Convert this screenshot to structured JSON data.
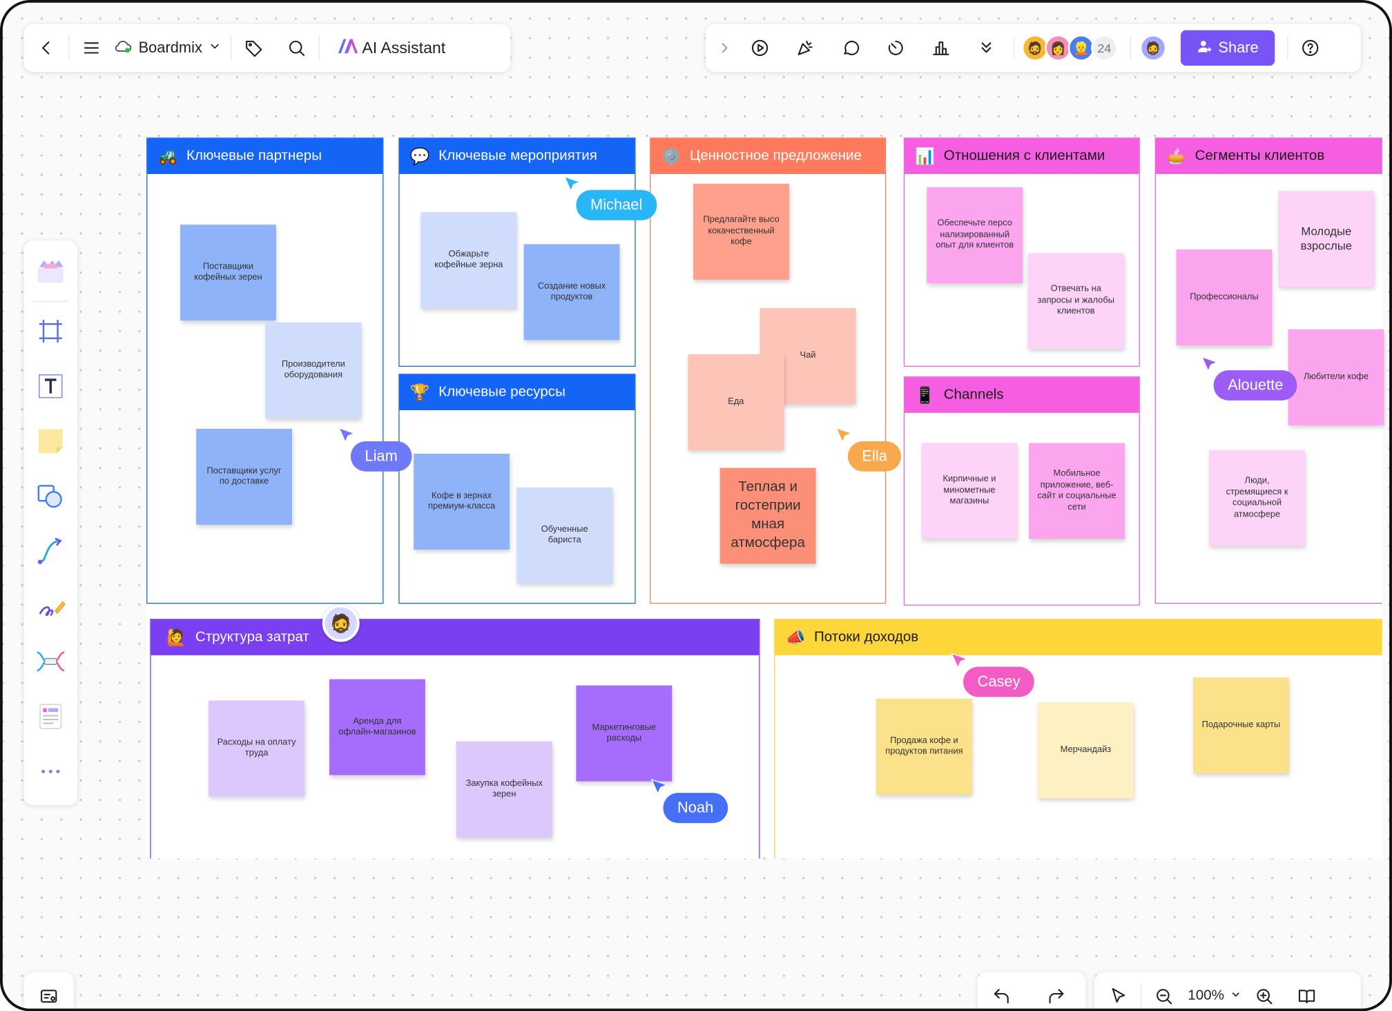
{
  "topbar": {
    "app_name": "Boardmix",
    "ai_label": "AI Assistant",
    "collab_count": "24",
    "share_label": "Share"
  },
  "zoom": {
    "value": "100%"
  },
  "colors": {
    "blue": "#1464f6",
    "salmon": "#ff7a5c",
    "pink": "#f55ee0",
    "purple": "#7b3ff2",
    "yellow": "#fdd73a",
    "share": "#7654f5"
  },
  "sections": {
    "partners": {
      "title": "Ключевые партнеры",
      "notes": [
        "Поставщики кофейных зерен",
        "Производители оборудования",
        "Поставщики услуг по доставке"
      ]
    },
    "activities": {
      "title": "Ключевые мероприятия",
      "notes": [
        "Обжарьте кофейные зерна",
        "Создание новых продуктов"
      ]
    },
    "resources": {
      "title": "Ключевые ресурсы",
      "notes": [
        "Кофе в зернах премиум-класса",
        "Обученные бариста"
      ]
    },
    "value": {
      "title": "Ценностное предложение",
      "notes": [
        "Предлагайте высо кокачественный кофе",
        "Чай",
        "Еда",
        "Теплая и гостеприи мная атмосфера"
      ]
    },
    "relations": {
      "title": "Отношения с клиентами",
      "notes": [
        "Обеспечьте персо нализированный опыт для клиентов",
        "Отвечать на запросы и жалобы клиентов"
      ]
    },
    "channels": {
      "title": "Channels",
      "notes": [
        "Кирпичные и минометные магазины",
        "Мобильное приложение, веб-сайт и социальные сети"
      ]
    },
    "segments": {
      "title": "Сегменты клиентов",
      "notes": [
        "Молодые взрослые",
        "Профессионалы",
        "Любители кофе",
        "Люди, стремящиеся к социальной атмосфере"
      ]
    },
    "costs": {
      "title": "Структура затрат",
      "notes": [
        "Расходы на оплату труда",
        "Аренда для офлайн-магазинов",
        "Закупка кофейных зерен",
        "Маркетинговые расходы"
      ]
    },
    "revenue": {
      "title": "Потоки доходов",
      "notes": [
        "Продажа кофе и продуктов питания",
        "Мерчандайз",
        "Подарочные карты"
      ]
    }
  },
  "cursors": [
    {
      "name": "Michael",
      "color": "#29b6f6"
    },
    {
      "name": "Liam",
      "color": "#6f79f5"
    },
    {
      "name": "Ella",
      "color": "#f7a94c"
    },
    {
      "name": "Alouette",
      "color": "#9b5df5"
    },
    {
      "name": "Casey",
      "color": "#f25cc4"
    },
    {
      "name": "Noah",
      "color": "#4570f5"
    }
  ]
}
